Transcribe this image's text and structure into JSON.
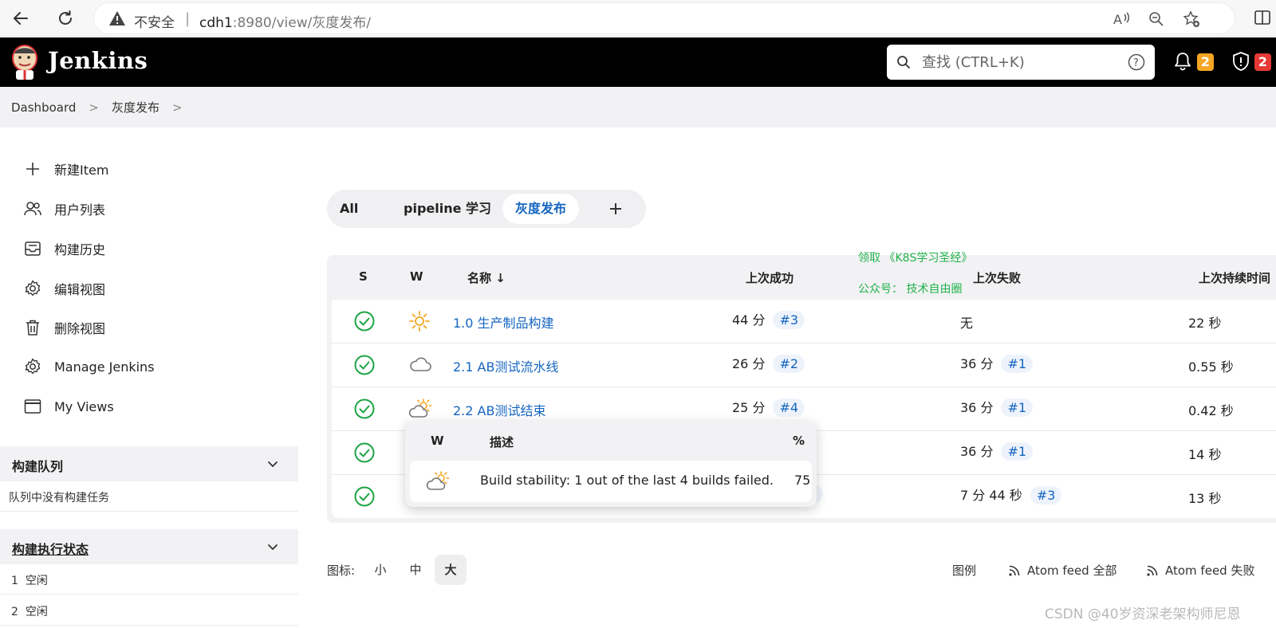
{
  "browser": {
    "insecure_label": "不安全",
    "separator": "|",
    "host": "cdh1",
    "path": ":8980/view/灰度发布/"
  },
  "header": {
    "brand": "Jenkins",
    "search_placeholder": "查找 (CTRL+K)",
    "notifications_count": "2",
    "security_count": "2"
  },
  "breadcrumb": {
    "items": [
      "Dashboard",
      "灰度发布"
    ],
    "separator": ">"
  },
  "sidebar": {
    "items": [
      {
        "label": "新建Item",
        "icon": "plus-icon"
      },
      {
        "label": "用户列表",
        "icon": "users-icon"
      },
      {
        "label": "构建历史",
        "icon": "inbox-icon"
      },
      {
        "label": "编辑视图",
        "icon": "gear-icon"
      },
      {
        "label": "删除视图",
        "icon": "trash-icon"
      },
      {
        "label": "Manage Jenkins",
        "icon": "gear-icon"
      },
      {
        "label": "My Views",
        "icon": "window-icon"
      }
    ],
    "build_queue": {
      "title": "构建队列",
      "empty_text": "队列中没有构建任务"
    },
    "executors": {
      "title": "构建执行状态",
      "items": [
        {
          "num": "1",
          "status": "空闲"
        },
        {
          "num": "2",
          "status": "空闲"
        }
      ]
    }
  },
  "tabs": [
    {
      "label": "All"
    },
    {
      "label": "pipeline 学习"
    },
    {
      "label": "灰度发布",
      "active": true
    }
  ],
  "table": {
    "headers": {
      "s": "S",
      "w": "W",
      "name": "名称 ↓",
      "last_success": "上次成功",
      "last_failure": "上次失败",
      "last_duration": "上次持续时间"
    },
    "rows": [
      {
        "name": "1.0 生产制品构建",
        "weather": "sunny",
        "success_time": "44 分",
        "success_build": "#3",
        "failure_time": "无",
        "failure_build": "",
        "duration": "22 秒"
      },
      {
        "name": "2.1 AB测试流水线",
        "weather": "cloudy",
        "success_time": "26 分",
        "success_build": "#2",
        "failure_time": "36 分",
        "failure_build": "#1",
        "duration": "0.55 秒"
      },
      {
        "name": "2.2 AB测试结束",
        "weather": "partly-sunny",
        "success_time": "25 分",
        "success_build": "#4",
        "failure_time": "36 分",
        "failure_build": "#1",
        "duration": "0.42 秒"
      },
      {
        "name": "",
        "weather": "",
        "success_time": "",
        "success_build": "",
        "failure_time": "36 分",
        "failure_build": "#1",
        "duration": "14 秒"
      },
      {
        "name": "",
        "weather": "",
        "success_time": "",
        "success_build": "5",
        "failure_time": "7 分 44 秒",
        "failure_build": "#3",
        "duration": "13 秒"
      }
    ]
  },
  "promo": {
    "line1": "领取 《K8S学习圣经》",
    "line2": "公众号： 技术自由圈"
  },
  "popup": {
    "headers": {
      "w": "W",
      "desc": "描述",
      "pct": "%"
    },
    "description": "Build stability: 1 out of the last 4 builds failed.",
    "percent": "75"
  },
  "footer": {
    "icon_label": "图标:",
    "sizes": [
      "小",
      "中",
      "大"
    ],
    "active_size": "大",
    "legend": "图例",
    "atom_all": "Atom feed 全部",
    "atom_fail": "Atom feed 失败"
  },
  "watermark": "CSDN @40岁资深老架构师尼恩",
  "colors": {
    "link": "#1565c0",
    "success": "#1ea446",
    "badge_orange": "#f5a623",
    "badge_red": "#e53935",
    "promo": "#22b24c"
  }
}
